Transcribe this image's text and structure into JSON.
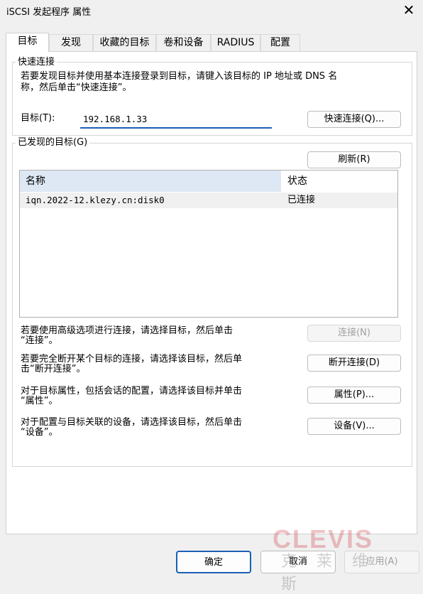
{
  "window": {
    "title": "iSCSI 发起程序 属性"
  },
  "tabs": [
    {
      "label": "目标"
    },
    {
      "label": "发现"
    },
    {
      "label": "收藏的目标"
    },
    {
      "label": "卷和设备"
    },
    {
      "label": "RADIUS"
    },
    {
      "label": "配置"
    }
  ],
  "quick_connect": {
    "legend": "快速连接",
    "instructions_line1": "若要发现目标并使用基本连接登录到目标，请键入该目标的 IP 地址或 DNS 名",
    "instructions_line2": "称，然后单击“快速连接”。",
    "target_label": "目标(T):",
    "target_value": "192.168.1.33",
    "button_label": "快速连接(Q)..."
  },
  "discovered": {
    "legend": "已发现的目标(G)",
    "refresh_label": "刷新(R)",
    "columns": [
      "名称",
      "状态"
    ],
    "rows": [
      {
        "name": "iqn.2022-12.klezy.cn:disk0",
        "status": "已连接"
      }
    ]
  },
  "actions": [
    {
      "line1": "若要使用高级选项进行连接，请选择目标，然后单击",
      "line2": "“连接”。",
      "button": "连接(N)",
      "disabled": true
    },
    {
      "line1": "若要完全断开某个目标的连接，请选择该目标，然后单",
      "line2": "击“断开连接”。",
      "button": "断开连接(D)",
      "disabled": false
    },
    {
      "line1": "对于目标属性，包括会话的配置，请选择该目标并单击",
      "line2": "“属性”。",
      "button": "属性(P)...",
      "disabled": false
    },
    {
      "line1": "对于配置与目标关联的设备，请选择该目标，然后单击",
      "line2": "“设备”。",
      "button": "设备(V)...",
      "disabled": false
    }
  ],
  "footer": {
    "ok_label": "确定",
    "cancel_label": "取消",
    "apply_label": "应用(A)"
  },
  "watermark": {
    "logo": "CLEVIS",
    "sub": "克莱维斯"
  },
  "icons": {
    "close": "close-icon"
  },
  "colors": {
    "focus_accent": "#1a5fb4",
    "selected_row": "#f0f0f0"
  }
}
